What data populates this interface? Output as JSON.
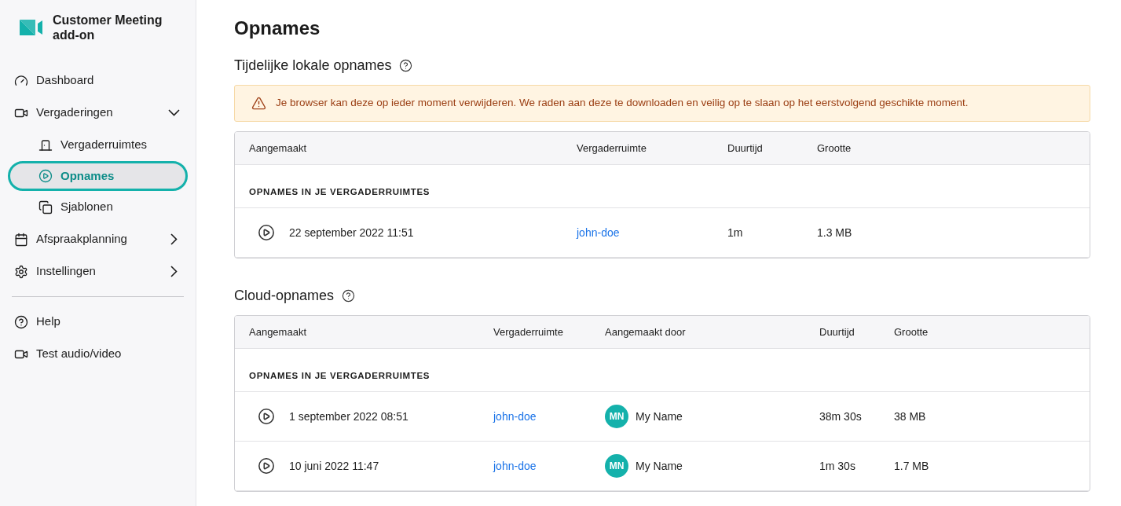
{
  "app": {
    "name": "Customer Meeting add-on"
  },
  "sidebar": {
    "nav": [
      {
        "label": "Dashboard",
        "kind": "link"
      },
      {
        "label": "Vergaderingen",
        "kind": "group",
        "expanded": true,
        "children": [
          {
            "label": "Vergaderruimtes",
            "selected": false
          },
          {
            "label": "Opnames",
            "selected": true
          },
          {
            "label": "Sjablonen",
            "selected": false
          }
        ]
      },
      {
        "label": "Afspraakplanning",
        "kind": "group",
        "expanded": false
      },
      {
        "label": "Instellingen",
        "kind": "group",
        "expanded": false
      }
    ],
    "footer_nav": [
      {
        "label": "Help"
      },
      {
        "label": "Test audio/video"
      }
    ]
  },
  "page": {
    "title": "Opnames"
  },
  "local_section": {
    "title": "Tijdelijke lokale opnames",
    "warning": "Je browser kan deze op ieder moment verwijderen. We raden aan deze te downloaden en veilig op te slaan op het eerstvolgend geschikte moment.",
    "table": {
      "columns": [
        "Aangemaakt",
        "Vergaderruimte",
        "Duurtijd",
        "Grootte"
      ],
      "group": "OPNAMES IN JE VERGADERRUIMTES",
      "rows": [
        {
          "created": "22 september 2022 11:51",
          "room": "john-doe",
          "duration": "1m",
          "size": "1.3 MB"
        }
      ]
    }
  },
  "cloud_section": {
    "title": "Cloud-opnames",
    "table": {
      "columns": [
        "Aangemaakt",
        "Vergaderruimte",
        "Aangemaakt door",
        "Duurtijd",
        "Grootte"
      ],
      "group": "OPNAMES IN JE VERGADERRUIMTES",
      "rows": [
        {
          "created": "1 september 2022 08:51",
          "room": "john-doe",
          "initials": "MN",
          "author": "My Name",
          "duration": "38m 30s",
          "size": "38 MB"
        },
        {
          "created": "10 juni 2022 11:47",
          "room": "john-doe",
          "initials": "MN",
          "author": "My Name",
          "duration": "1m 30s",
          "size": "1.7 MB"
        }
      ]
    }
  }
}
